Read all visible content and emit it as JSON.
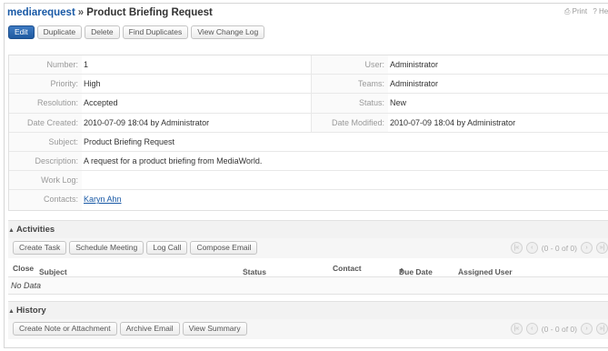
{
  "header": {
    "module": "mediarequest",
    "separator": "»",
    "record_title": "Product Briefing Request",
    "print_label": "Print",
    "help_label": "? Hel"
  },
  "toolbar": [
    "Edit",
    "Duplicate",
    "Delete",
    "Find Duplicates",
    "View Change Log"
  ],
  "fields": {
    "number": {
      "label": "Number:",
      "value": "1"
    },
    "user": {
      "label": "User:",
      "value": "Administrator"
    },
    "priority": {
      "label": "Priority:",
      "value": "High"
    },
    "teams": {
      "label": "Teams:",
      "value": "Administrator"
    },
    "resolution": {
      "label": "Resolution:",
      "value": "Accepted"
    },
    "status": {
      "label": "Status:",
      "value": "New"
    },
    "date_created": {
      "label": "Date Created:",
      "value": "2010-07-09 18:04 by Administrator"
    },
    "date_modified": {
      "label": "Date Modified:",
      "value": "2010-07-09 18:04 by Administrator"
    },
    "subject": {
      "label": "Subject:",
      "value": "Product Briefing Request"
    },
    "description": {
      "label": "Description:",
      "value": "A request for a product briefing from MediaWorld."
    },
    "work_log": {
      "label": "Work Log:",
      "value": ""
    },
    "contacts": {
      "label": "Contacts:",
      "value": "Karyn Ahn"
    }
  },
  "activities": {
    "title": "Activities",
    "buttons": [
      "Create Task",
      "Schedule Meeting",
      "Log Call",
      "Compose Email"
    ],
    "pager_text": "(0 - 0 of 0)",
    "columns": [
      "Close",
      "Subject",
      "Status",
      "Contact",
      "Due Date",
      "Assigned User"
    ],
    "empty_text": "No Data"
  },
  "history": {
    "title": "History",
    "buttons": [
      "Create Note or Attachment",
      "Archive Email",
      "View Summary"
    ],
    "pager_text": "(0 - 0 of 0)"
  }
}
